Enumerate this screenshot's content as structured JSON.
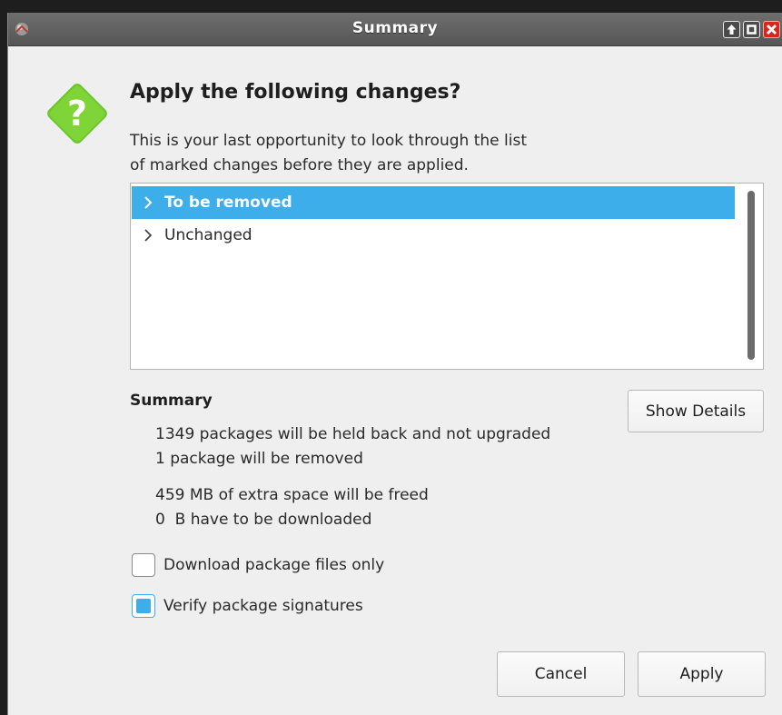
{
  "window": {
    "title": "Summary"
  },
  "dialog": {
    "heading": "Apply the following changes?",
    "description_line1": "This is your last opportunity to look through the list",
    "description_line2": "of marked changes before they are applied."
  },
  "changes_list": {
    "items": [
      {
        "label": "To be removed",
        "selected": true
      },
      {
        "label": "Unchanged",
        "selected": false
      }
    ]
  },
  "summary": {
    "heading": "Summary",
    "show_details_label": "Show Details",
    "lines": [
      "1349 packages will be held back and not upgraded",
      "1 package will be removed",
      "459 MB of extra space will be freed",
      "0  B have to be downloaded"
    ]
  },
  "options": {
    "download_only": {
      "label": "Download package files only",
      "checked": false
    },
    "verify_signatures": {
      "label": "Verify package signatures",
      "checked": true
    }
  },
  "buttons": {
    "cancel": "Cancel",
    "apply": "Apply"
  },
  "colors": {
    "selection": "#3daee9",
    "titlebar": "#5e5e5e",
    "close_button": "#d9261c",
    "question_icon": "#6cc52b"
  },
  "icons": {
    "app": "application-icon",
    "question": "question-mark-icon",
    "expander": "chevron-right-icon"
  }
}
